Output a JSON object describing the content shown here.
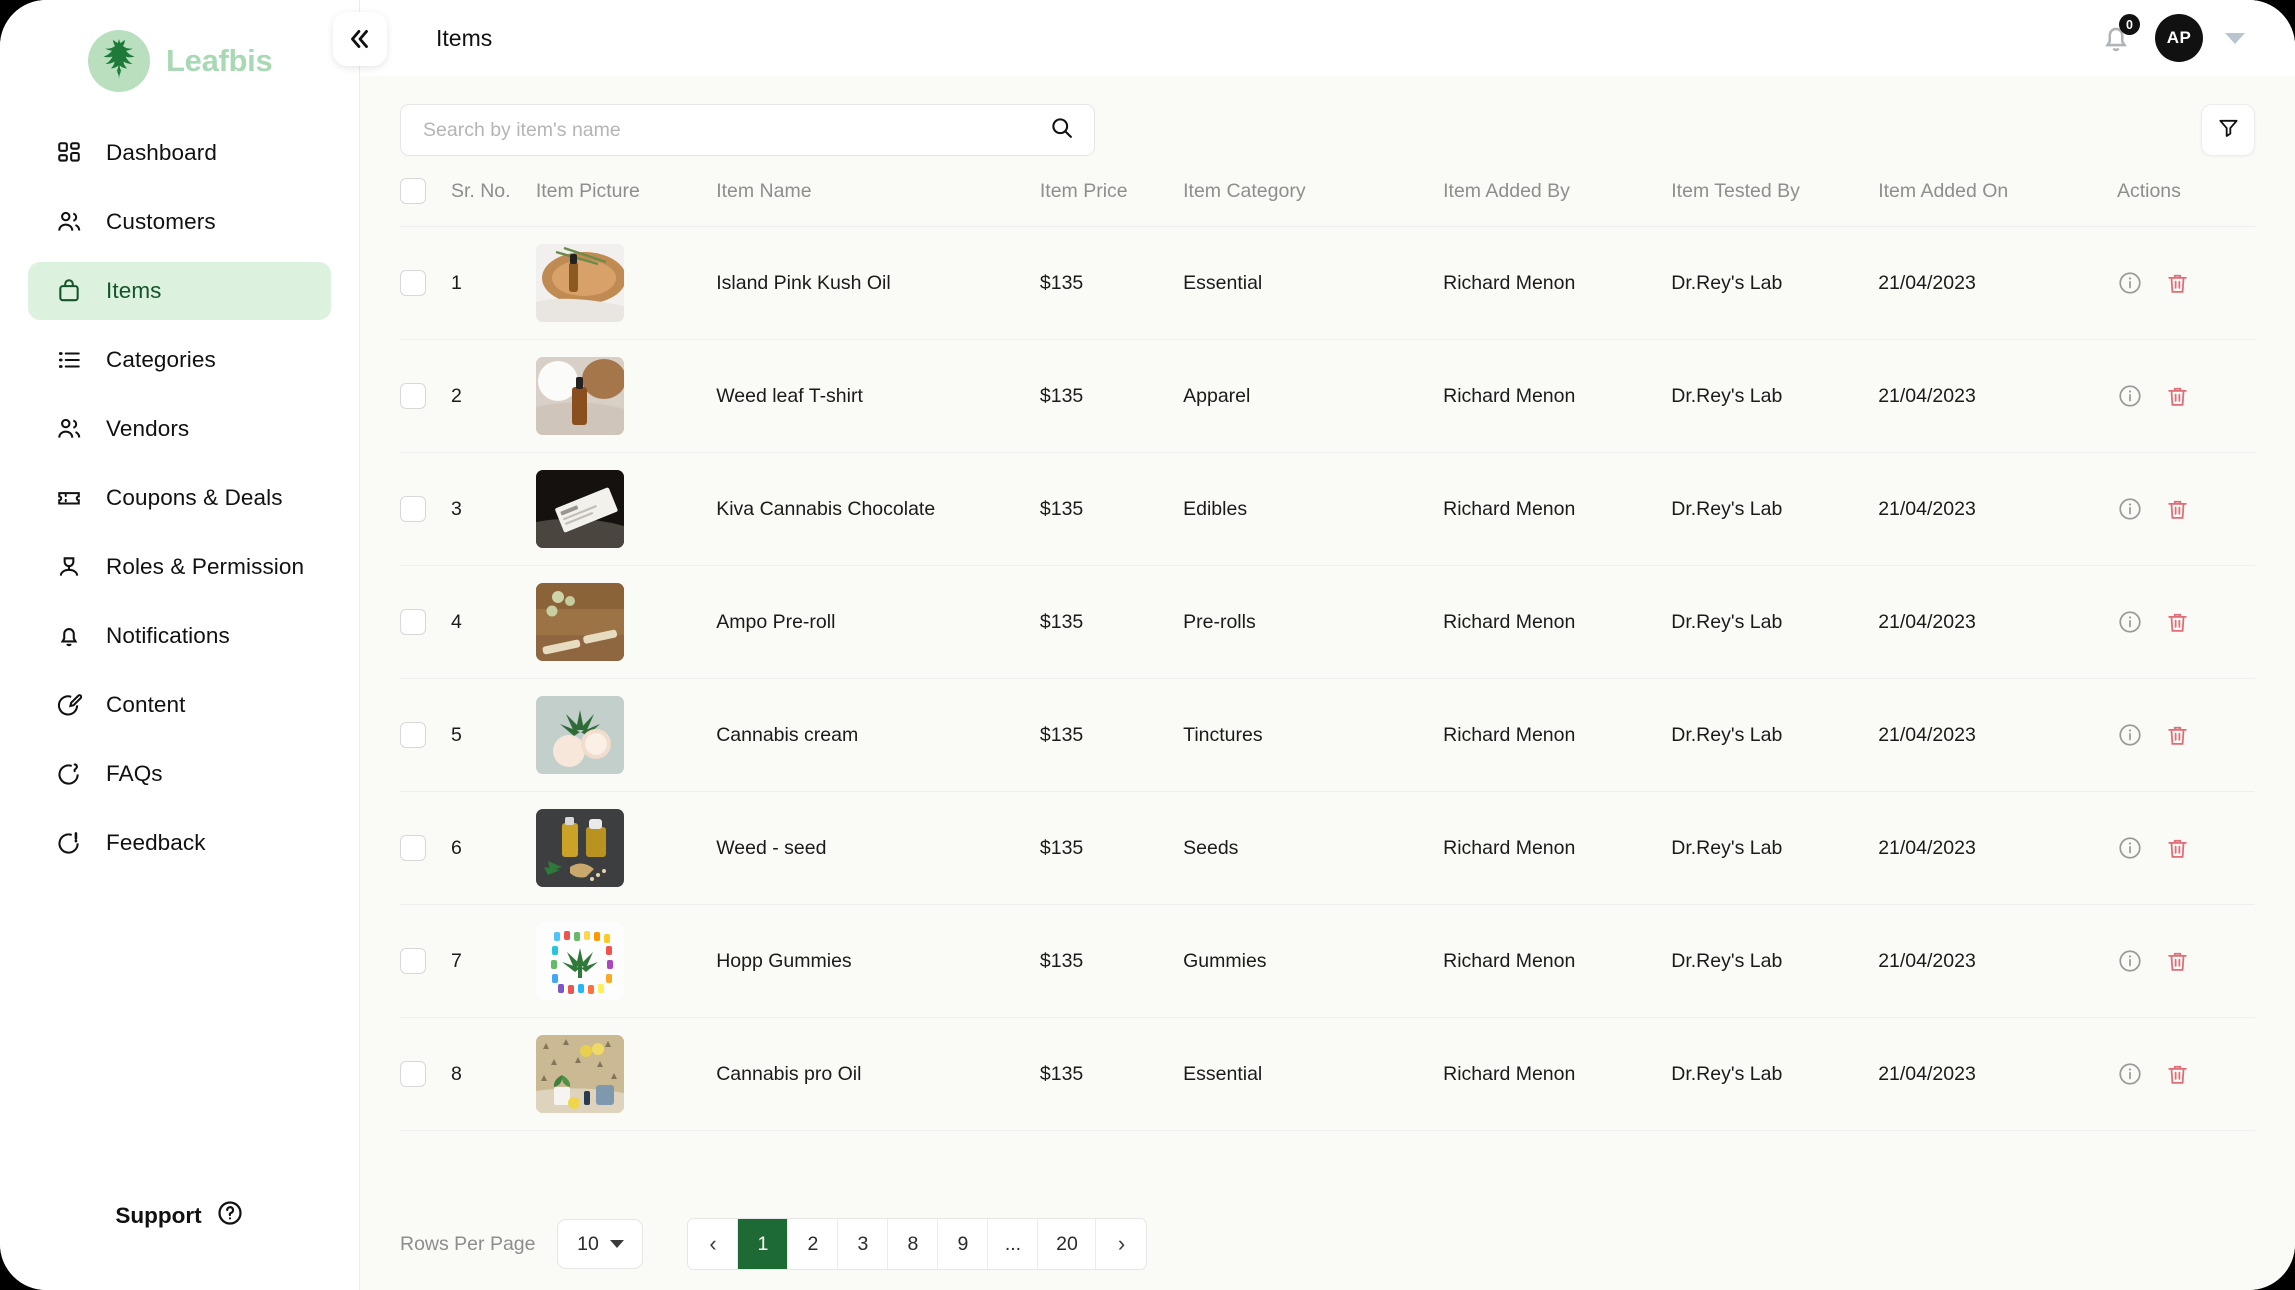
{
  "brand": {
    "name": "Leafbis",
    "logo_icon": "cannabis-leaf-icon"
  },
  "sidebar": {
    "items": [
      {
        "label": "Dashboard",
        "icon": "grid-icon",
        "active": false
      },
      {
        "label": "Customers",
        "icon": "users-icon",
        "active": false
      },
      {
        "label": "Items",
        "icon": "bag-icon",
        "active": true
      },
      {
        "label": "Categories",
        "icon": "list-icon",
        "active": false
      },
      {
        "label": "Vendors",
        "icon": "users-icon",
        "active": false
      },
      {
        "label": "Coupons & Deals",
        "icon": "ticket-icon",
        "active": false
      },
      {
        "label": "Roles & Permission",
        "icon": "user-shield-icon",
        "active": false
      },
      {
        "label": "Notifications",
        "icon": "bell-icon",
        "active": false
      },
      {
        "label": "Content",
        "icon": "edit-icon",
        "active": false
      },
      {
        "label": "FAQs",
        "icon": "question-chat-icon",
        "active": false
      },
      {
        "label": "Feedback",
        "icon": "feedback-chat-icon",
        "active": false
      }
    ],
    "support_label": "Support",
    "support_icon": "question-circle-icon"
  },
  "topbar": {
    "title": "Items",
    "collapse_icon": "chevrons-left-icon",
    "bell_icon": "bell-icon",
    "notification_count": "0",
    "avatar_initials": "AP",
    "caret_icon": "chevron-down-icon"
  },
  "toolbar": {
    "search_placeholder": "Search by item's name",
    "search_value": "",
    "search_icon": "search-icon",
    "filter_icon": "filter-funnel-icon"
  },
  "table": {
    "columns": [
      "Sr. No.",
      "Item Picture",
      "Item Name",
      "Item Price",
      "Item Category",
      "Item Added By",
      "Item Tested By",
      "Item Added On",
      "Actions"
    ],
    "rows": [
      {
        "sr": "1",
        "name": "Island Pink Kush Oil",
        "price": "$135",
        "category": "Essential",
        "added_by": "Richard Menon",
        "tested_by": "Dr.Rey's Lab",
        "added_on": "21/04/2023",
        "thumb": "oil-dropper-on-wood"
      },
      {
        "sr": "2",
        "name": "Weed leaf T-shirt",
        "price": "$135",
        "category": "Apparel",
        "added_by": "Richard Menon",
        "tested_by": "Dr.Rey's Lab",
        "added_on": "21/04/2023",
        "thumb": "amber-bottle-on-cloth"
      },
      {
        "sr": "3",
        "name": "Kiva Cannabis Chocolate",
        "price": "$135",
        "category": "Edibles",
        "added_by": "Richard Menon",
        "tested_by": "Dr.Rey's Lab",
        "added_on": "21/04/2023",
        "thumb": "white-bar-on-dark"
      },
      {
        "sr": "4",
        "name": "Ampo Pre-roll",
        "price": "$135",
        "category": "Pre-rolls",
        "added_by": "Richard Menon",
        "tested_by": "Dr.Rey's Lab",
        "added_on": "21/04/2023",
        "thumb": "prerolls-on-wood"
      },
      {
        "sr": "5",
        "name": "Cannabis cream",
        "price": "$135",
        "category": "Tinctures",
        "added_by": "Richard Menon",
        "tested_by": "Dr.Rey's Lab",
        "added_on": "21/04/2023",
        "thumb": "cream-jars-with-leaf"
      },
      {
        "sr": "6",
        "name": "Weed - seed",
        "price": "$135",
        "category": "Seeds",
        "added_by": "Richard Menon",
        "tested_by": "Dr.Rey's Lab",
        "added_on": "21/04/2023",
        "thumb": "oil-bottles-seeds-dark"
      },
      {
        "sr": "7",
        "name": "Hopp Gummies",
        "price": "$135",
        "category": "Gummies",
        "added_by": "Richard Menon",
        "tested_by": "Dr.Rey's Lab",
        "added_on": "21/04/2023",
        "thumb": "gummies-around-leaf"
      },
      {
        "sr": "8",
        "name": "Cannabis pro Oil",
        "price": "$135",
        "category": "Essential",
        "added_by": "Richard Menon",
        "tested_by": "Dr.Rey's Lab",
        "added_on": "21/04/2023",
        "thumb": "products-on-counter"
      }
    ],
    "row_action_icons": {
      "info": "info-circle-icon",
      "delete": "trash-icon"
    }
  },
  "pagination": {
    "rows_per_page_label": "Rows Per Page",
    "rows_per_page_value": "10",
    "prev_icon": "chevron-left-icon",
    "next_icon": "chevron-right-icon",
    "pages": [
      "1",
      "2",
      "3",
      "8",
      "9",
      "...",
      "20"
    ],
    "current_page": "1"
  },
  "colors": {
    "brand_green": "#a9d9b4",
    "active_nav_bg": "#dcf1de",
    "active_nav_text": "#14542a",
    "pager_active_bg": "#1d6a34",
    "delete_icon": "#e06c77",
    "page_bg": "#fafaf6"
  }
}
